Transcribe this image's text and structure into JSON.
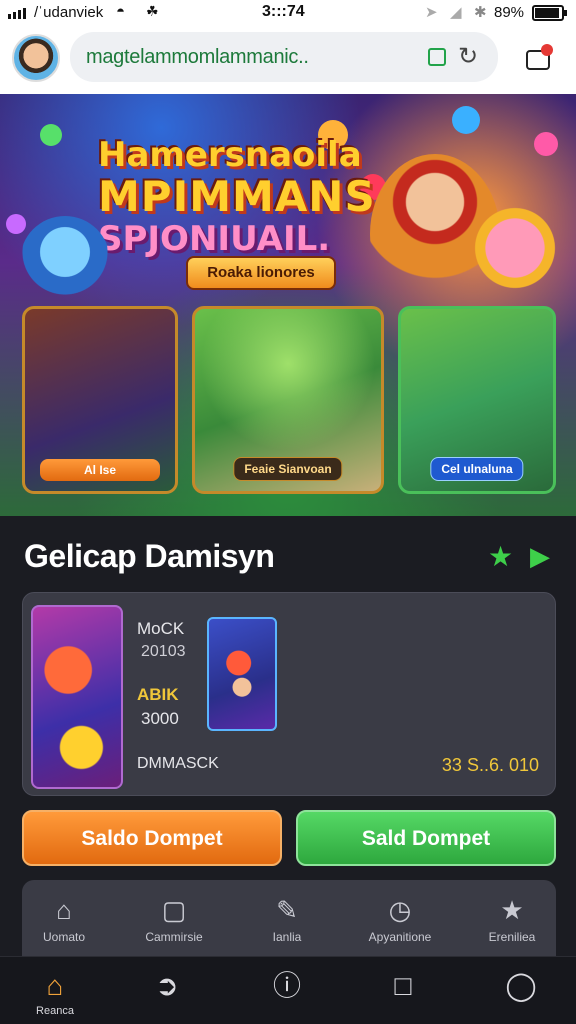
{
  "status_bar": {
    "carrier": "/ˈudanviek",
    "time": "3:::74",
    "battery": "89%"
  },
  "browser": {
    "url": "magtelammomlammanic..",
    "icons": [
      "avatar",
      "lock-icon",
      "reload-icon",
      "notification-icon"
    ]
  },
  "hero": {
    "title_line1": "Hamersnaoila",
    "title_line2": "MPIMMANS",
    "title_line3": "SPJONIUAIL.",
    "badge": "Roaka lionores",
    "card_captions": [
      "Al Ise",
      "Feaie Sianvoan",
      "Cel ulnaluna"
    ]
  },
  "section": {
    "title": "Gelicap Damisyn"
  },
  "panel": {
    "label1": "MoCK",
    "value1": "20103",
    "label2": "ABIK",
    "value2": "3000",
    "label3": "DMMASCK",
    "amount": "33 S..6. 010"
  },
  "buttons": {
    "left": "Saldo Dompet",
    "right": "Sald Dompet"
  },
  "subnav": [
    {
      "label": "Uomato",
      "icon": "home-icon"
    },
    {
      "label": "Cammirsie",
      "icon": "refresh-icon"
    },
    {
      "label": "Ianlia",
      "icon": "edit-icon"
    },
    {
      "label": "Apyanitione",
      "icon": "gauge-icon"
    },
    {
      "label": "Ereniliea",
      "icon": "star-icon"
    }
  ],
  "tabbar": [
    {
      "label": "Reanca",
      "icon": "home-icon"
    },
    {
      "label": "",
      "icon": "send-icon"
    },
    {
      "label": "",
      "icon": "info-icon"
    },
    {
      "label": "",
      "icon": "book-icon"
    },
    {
      "label": "",
      "icon": "user-icon"
    }
  ],
  "colors": {
    "accent_green": "#3ecf4a",
    "accent_orange": "#ef7d1f",
    "gold": "#f0c73a",
    "background": "#1b1c22"
  }
}
